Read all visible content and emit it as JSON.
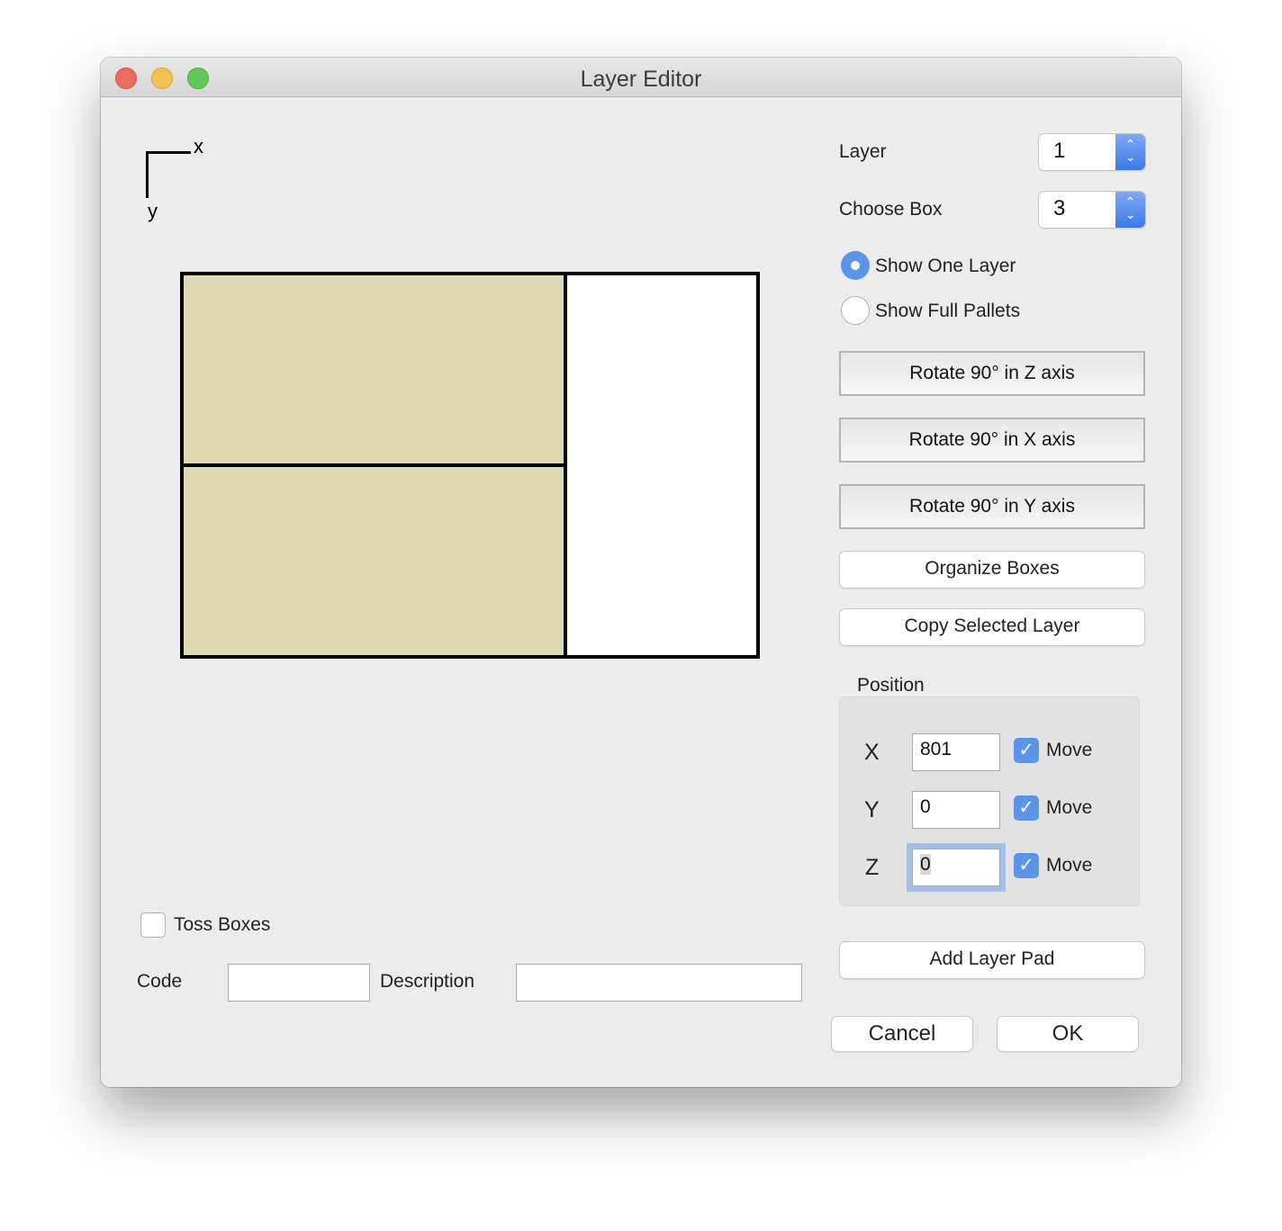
{
  "window": {
    "title": "Layer Editor"
  },
  "axis_legend": {
    "x_label": "x",
    "y_label": "y"
  },
  "layer_view": {
    "boxes": [
      {
        "id": 1,
        "fill": "#dfdab6",
        "selected": false
      },
      {
        "id": 2,
        "fill": "#dfdab6",
        "selected": false
      },
      {
        "id": 3,
        "fill": "#ffffff",
        "selected": true
      }
    ]
  },
  "controls": {
    "layer": {
      "label": "Layer",
      "value": "1"
    },
    "choose_box": {
      "label": "Choose Box",
      "value": "3"
    },
    "view_mode": {
      "options": [
        {
          "label": "Show One Layer",
          "selected": true
        },
        {
          "label": "Show Full Pallets",
          "selected": false
        }
      ]
    },
    "rotate_buttons": [
      {
        "label": "Rotate 90° in Z axis"
      },
      {
        "label": "Rotate 90° in X axis"
      },
      {
        "label": "Rotate 90° in Y axis"
      }
    ],
    "organize_label": "Organize Boxes",
    "copy_layer_label": "Copy Selected Layer"
  },
  "position": {
    "title": "Position",
    "rows": [
      {
        "axis": "X",
        "value": "801",
        "move_label": "Move",
        "move_checked": true,
        "focused": false
      },
      {
        "axis": "Y",
        "value": "0",
        "move_label": "Move",
        "move_checked": true,
        "focused": false
      },
      {
        "axis": "Z",
        "value": "0",
        "move_label": "Move",
        "move_checked": true,
        "focused": true
      }
    ]
  },
  "add_layer_pad_label": "Add Layer Pad",
  "toss_boxes": {
    "label": "Toss Boxes",
    "checked": false
  },
  "code": {
    "label": "Code",
    "value": ""
  },
  "description": {
    "label": "Description",
    "value": ""
  },
  "dialog": {
    "cancel_label": "Cancel",
    "ok_label": "OK"
  },
  "icons": {
    "checkmark": "✓",
    "stepper": "⌃⌄"
  }
}
